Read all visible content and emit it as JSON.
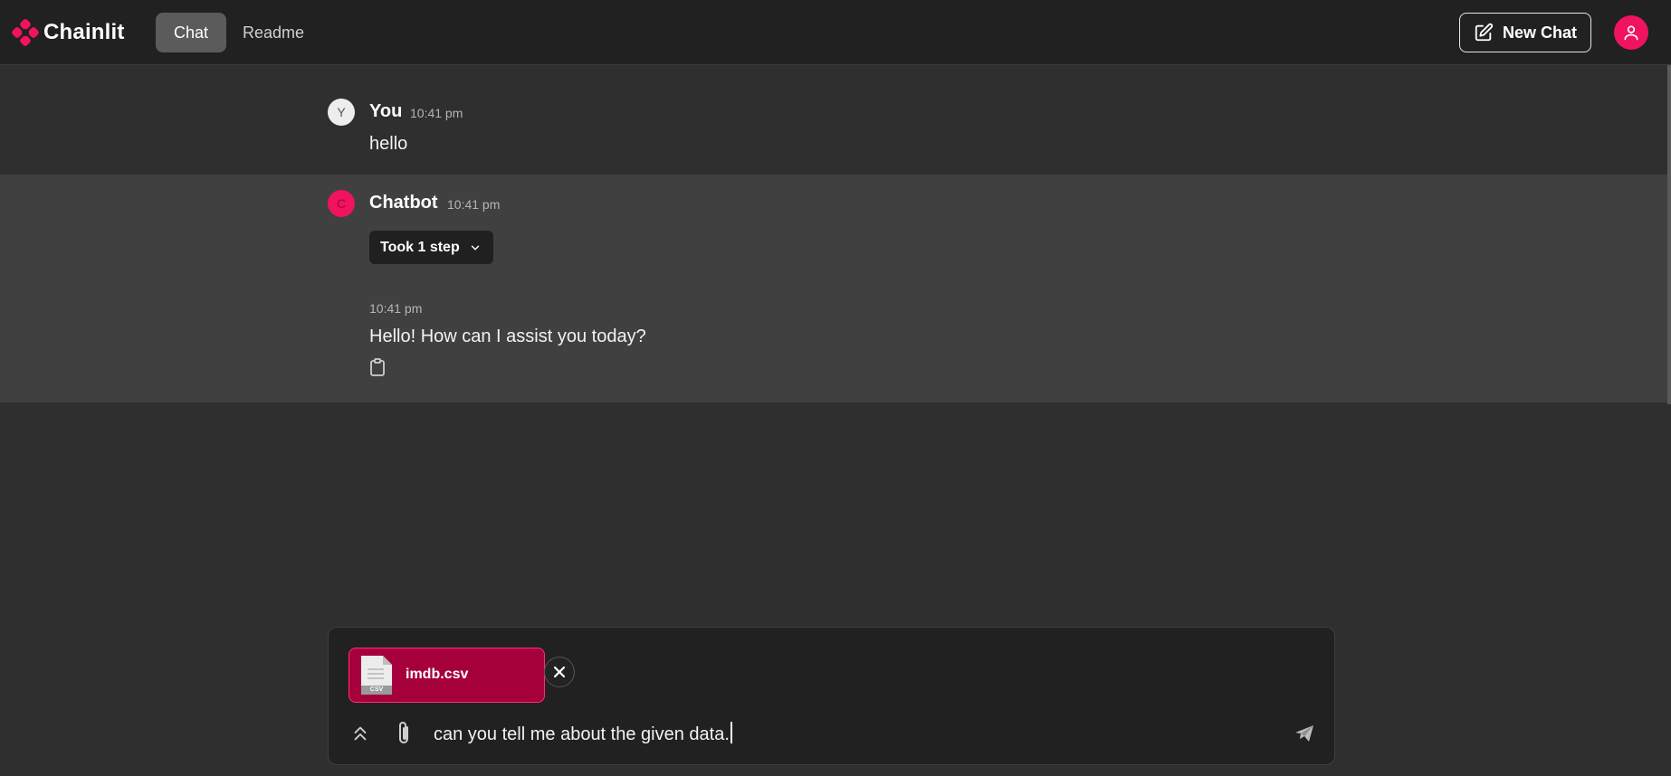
{
  "header": {
    "logo_text": "Chainlit",
    "tabs": [
      {
        "label": "Chat",
        "active": true
      },
      {
        "label": "Readme",
        "active": false
      }
    ],
    "new_chat_label": "New Chat",
    "icons": {
      "new_chat": "edit-icon",
      "user": "user-icon"
    }
  },
  "messages": [
    {
      "author": "You",
      "avatar_initial": "Y",
      "time": "10:41 pm",
      "text": "hello"
    },
    {
      "author": "Chatbot",
      "avatar_initial": "C",
      "time": "10:41 pm",
      "step_label": "Took 1 step",
      "reply_time": "10:41 pm",
      "text": "Hello! How can I assist you today?"
    }
  ],
  "composer": {
    "attachment": {
      "file_name": "imdb.csv",
      "file_type": "CSV"
    },
    "input_value": "can you tell me about the given data."
  },
  "colors": {
    "accent": "#f0135f",
    "attachment_bg": "#a6003c",
    "header_bg": "#212121",
    "page_bg": "#2f2f2f",
    "bot_message_bg": "#404040"
  }
}
